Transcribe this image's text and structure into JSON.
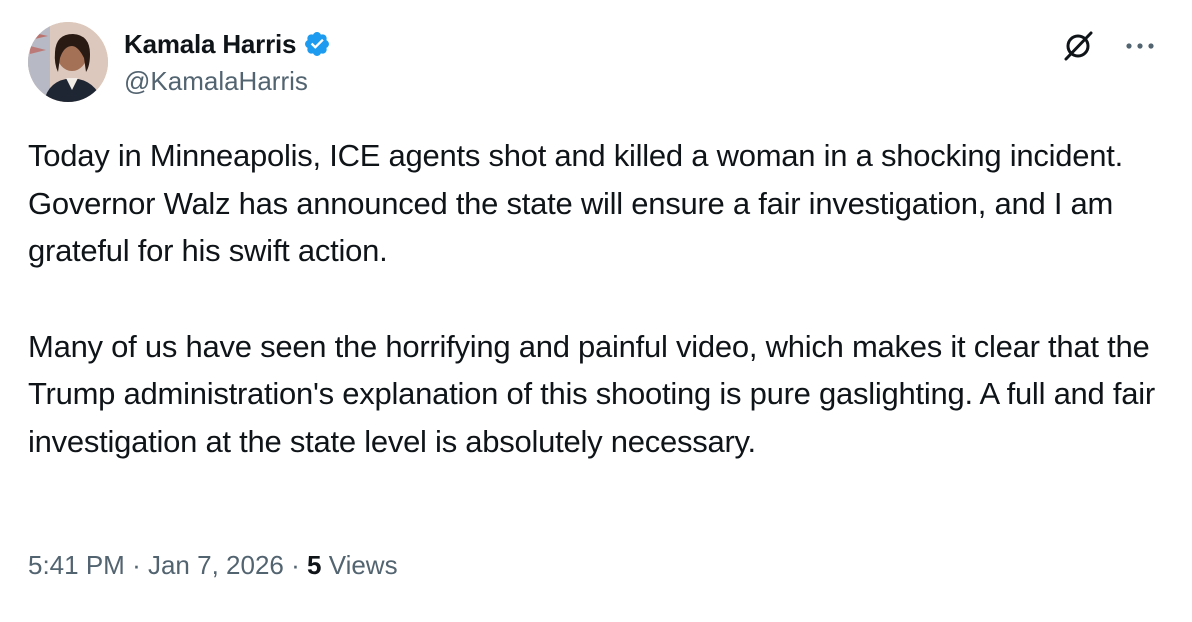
{
  "author": {
    "display_name": "Kamala Harris",
    "handle": "@KamalaHarris",
    "verified": true,
    "verified_badge_color": "#1d9bf0"
  },
  "icons": {
    "grok": "grok-icon",
    "more": "more-options-icon",
    "verified": "verified-badge-icon"
  },
  "body": {
    "paragraphs": [
      "Today in Minneapolis, ICE agents shot and killed a woman in a shocking incident. Governor Walz has announced the state will ensure a fair investigation, and I am grateful for his swift action.",
      "Many of us have seen the horrifying and painful video, which makes it clear that the Trump administration's explanation of this shooting is pure gaslighting. A full and fair investigation at the state level is absolutely necessary."
    ]
  },
  "meta": {
    "time": "5:41 PM",
    "separator": "·",
    "date": "Jan 7, 2026",
    "views_count": "5",
    "views_label": "Views"
  },
  "colors": {
    "text_primary": "#0f1419",
    "text_secondary": "#536471",
    "background": "#ffffff"
  }
}
